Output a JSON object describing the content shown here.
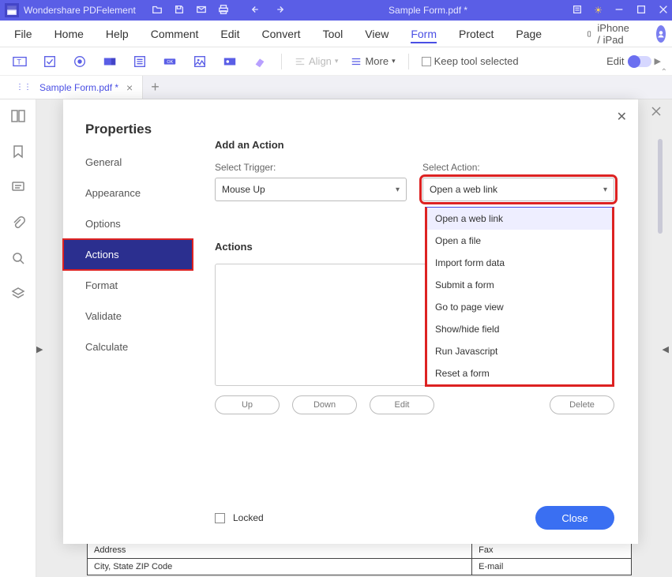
{
  "titlebar": {
    "app_name": "Wondershare PDFelement",
    "document": "Sample Form.pdf *"
  },
  "menubar": {
    "items": [
      "File",
      "Home",
      "Help",
      "Comment",
      "Edit",
      "Convert",
      "Tool",
      "View",
      "Form",
      "Protect",
      "Page"
    ],
    "active_index": 8,
    "device_label": "iPhone / iPad"
  },
  "toolbar": {
    "align_label": "Align",
    "more_label": "More",
    "keep_tool_label": "Keep tool selected",
    "edit_label": "Edit"
  },
  "tab": {
    "label": "Sample Form.pdf *"
  },
  "modal": {
    "title": "Properties",
    "side_items": [
      "General",
      "Appearance",
      "Options",
      "Actions",
      "Format",
      "Validate",
      "Calculate"
    ],
    "active_side_index": 3,
    "section_title": "Add an Action",
    "trigger_label": "Select Trigger:",
    "trigger_value": "Mouse Up",
    "action_label": "Select Action:",
    "action_value": "Open a web link",
    "action_options": [
      "Open a web link",
      "Open a file",
      "Import form data",
      "Submit a form",
      "Go to page view",
      "Show/hide field",
      "Run Javascript",
      "Reset a form"
    ],
    "actions_heading": "Actions",
    "btn_up": "Up",
    "btn_down": "Down",
    "btn_edit": "Edit",
    "btn_delete": "Delete",
    "locked_label": "Locked",
    "close_label": "Close"
  },
  "doc": {
    "row1a": "Address",
    "row1b": "Fax",
    "row2a": "City, State ZIP Code",
    "row2b": "E-mail"
  }
}
